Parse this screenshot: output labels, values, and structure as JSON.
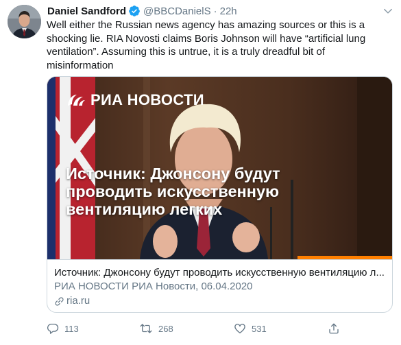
{
  "tweet": {
    "display_name": "Daniel Sandford",
    "handle": "@BBCDanielS",
    "separator": "·",
    "time": "22h",
    "text": "Well either the Russian news agency has amazing sources or this is a shocking lie. RIA Novosti claims Boris Johnson will have “artificial lung ventilation”. Assuming this is untrue, it is a truly dreadful bit of misinformation"
  },
  "card": {
    "logo_text": "РИА НОВОСТИ",
    "image_headline": "Источник: Джонсону будут проводить искусственную вентиляцию легких",
    "title": "Источник: Джонсону будут проводить искусственную вентиляцию л...",
    "description": "РИА НОВОСТИ РИА Новости, 06.04.2020",
    "domain": "ria.ru"
  },
  "actions": {
    "reply_count": "113",
    "retweet_count": "268",
    "like_count": "531"
  },
  "colors": {
    "verified": "#1da1f2",
    "secondary_text": "#657786",
    "border": "#ccd6dd",
    "ria_orange": "#ff7f00"
  },
  "icons": [
    "verified-badge-icon",
    "chevron-down-icon",
    "link-icon",
    "reply-icon",
    "retweet-icon",
    "like-icon",
    "share-icon"
  ]
}
